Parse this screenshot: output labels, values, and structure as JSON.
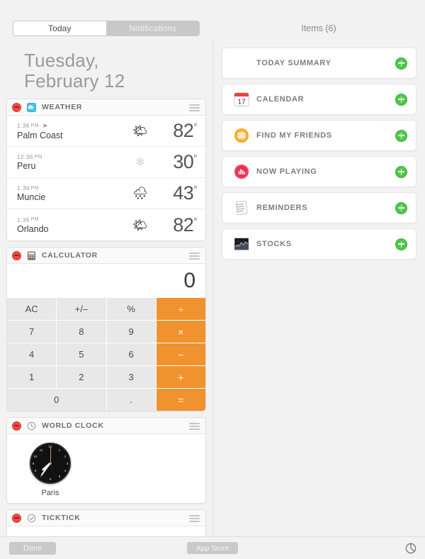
{
  "tabs": {
    "today_label": "Today",
    "notifications_label": "Notifications",
    "selected": "Today"
  },
  "items_header": "Items (6)",
  "date": {
    "line1": "Tuesday,",
    "line2": "February 12"
  },
  "widgets": [
    {
      "id": "weather",
      "title": "WEATHER",
      "icon": "weather-app-icon",
      "rows": [
        {
          "time": "1:36",
          "ampm": "PM",
          "has_location_arrow": true,
          "city": "Palm Coast",
          "icon": "sun-behind-cloud-icon",
          "temp": "82",
          "degree": "°"
        },
        {
          "time": "12:36",
          "ampm": "PM",
          "has_location_arrow": false,
          "city": "Peru",
          "icon": "snowflake-icon",
          "temp": "30",
          "degree": "°"
        },
        {
          "time": "1:36",
          "ampm": "PM",
          "has_location_arrow": false,
          "city": "Muncie",
          "icon": "cloud-with-rain-icon",
          "temp": "43",
          "degree": "°"
        },
        {
          "time": "1:36",
          "ampm": "PM",
          "has_location_arrow": false,
          "city": "Orlando",
          "icon": "sun-behind-cloud-icon",
          "temp": "82",
          "degree": "°"
        }
      ]
    },
    {
      "id": "calculator",
      "title": "CALCULATOR",
      "icon": "calculator-app-icon",
      "display": "0",
      "keys": [
        {
          "label": "AC",
          "type": "fn"
        },
        {
          "label": "+/–",
          "type": "fn"
        },
        {
          "label": "%",
          "type": "fn"
        },
        {
          "label": "÷",
          "type": "op"
        },
        {
          "label": "7",
          "type": "num"
        },
        {
          "label": "8",
          "type": "num"
        },
        {
          "label": "9",
          "type": "num"
        },
        {
          "label": "×",
          "type": "op"
        },
        {
          "label": "4",
          "type": "num"
        },
        {
          "label": "5",
          "type": "num"
        },
        {
          "label": "6",
          "type": "num"
        },
        {
          "label": "−",
          "type": "op"
        },
        {
          "label": "1",
          "type": "num"
        },
        {
          "label": "2",
          "type": "num"
        },
        {
          "label": "3",
          "type": "num"
        },
        {
          "label": "+",
          "type": "op"
        },
        {
          "label": "0",
          "type": "zero"
        },
        {
          "label": ".",
          "type": "num"
        },
        {
          "label": "=",
          "type": "op"
        }
      ]
    },
    {
      "id": "world-clock",
      "title": "WORLD CLOCK",
      "icon": "clock-app-icon",
      "clocks": [
        {
          "city": "Paris",
          "hour_deg": 228,
          "minute_deg": 216,
          "second_deg": 0
        }
      ],
      "clock_numerals": [
        "12",
        "1",
        "2",
        "3",
        "4",
        "5",
        "6",
        "7",
        "8",
        "9",
        "10",
        "11"
      ]
    },
    {
      "id": "ticktick",
      "title": "TICKTICK",
      "icon": "ticktick-app-icon"
    }
  ],
  "available_items": [
    {
      "label": "TODAY SUMMARY",
      "icon": "none",
      "add": "add-icon"
    },
    {
      "label": "CALENDAR",
      "icon": "calendar-icon",
      "icon_day": "17",
      "add": "add-icon"
    },
    {
      "label": "FIND MY FRIENDS",
      "icon": "find-my-friends-icon",
      "add": "add-icon"
    },
    {
      "label": "NOW PLAYING",
      "icon": "now-playing-icon",
      "add": "add-icon"
    },
    {
      "label": "REMINDERS",
      "icon": "reminders-icon",
      "add": "add-icon"
    },
    {
      "label": "STOCKS",
      "icon": "stocks-icon",
      "add": "add-icon"
    }
  ],
  "bottom_bar": {
    "done_label": "Done",
    "app_store_label": "App Store",
    "settings_icon": "gear-icon"
  },
  "colors": {
    "accent_orange": "#f0922e",
    "add_green": "#4cc948",
    "remove_red": "#ee4b42",
    "background": "#f2f2f2"
  }
}
